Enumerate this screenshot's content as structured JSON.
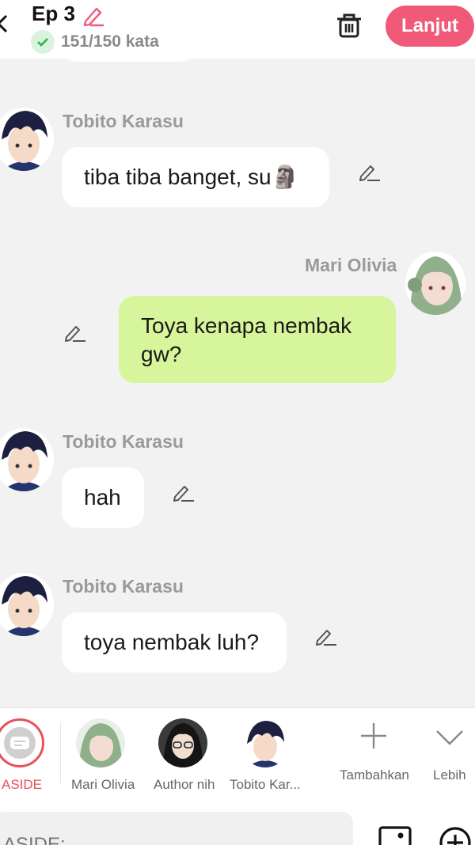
{
  "header": {
    "episode": "Ep 3",
    "word_count": "151/150 kata",
    "continue_label": "Lanjut",
    "accent_color": "#f05a78"
  },
  "messages": [
    {
      "sender": "Tobito Karasu",
      "text": "tiba tiba banget, su🗿",
      "side": "left"
    },
    {
      "sender": "Mari Olivia",
      "text": "Toya kenapa nembak gw?",
      "side": "right"
    },
    {
      "sender": "Tobito Karasu",
      "text": "hah",
      "side": "left"
    },
    {
      "sender": "Tobito Karasu",
      "text": "toya nembak luh?",
      "side": "left"
    }
  ],
  "characters": [
    {
      "label": "ASIDE",
      "icon": "aside-icon",
      "selected": true
    },
    {
      "label": "Mari Olivia",
      "icon": "avatar-mari"
    },
    {
      "label": "Author nih",
      "icon": "avatar-author"
    },
    {
      "label": "Tobito Kar...",
      "icon": "avatar-tobito"
    }
  ],
  "actions": {
    "add_label": "Tambahkan",
    "more_label": "Lebih"
  },
  "composer": {
    "placeholder": "ASIDE:"
  }
}
